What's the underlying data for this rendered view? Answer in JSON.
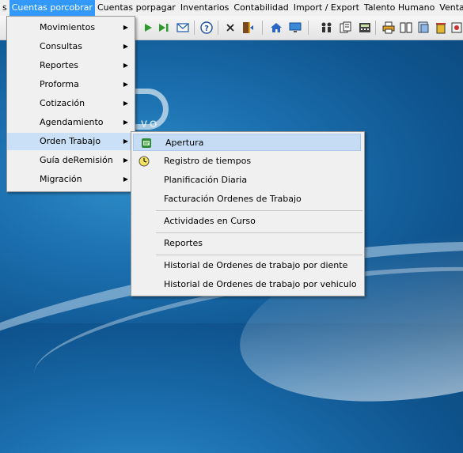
{
  "menubar": {
    "items": [
      "s",
      "Cuentas porcobrar",
      "Cuentas porpagar",
      "Inventarios",
      "Contabilidad",
      "Import / Export",
      "Talento Humano",
      "Ventana"
    ]
  },
  "toolbar": {
    "icons": [
      "play-icon",
      "skip-forward-icon",
      "mail-icon",
      "help-icon",
      "close-icon",
      "exit-door-icon",
      "home-icon",
      "monitor-icon",
      "users-icon",
      "documents-icon",
      "calculator-icon",
      "printer-icon",
      "book-icon",
      "window-icon",
      "trash-icon",
      "config-icon"
    ]
  },
  "submenu": {
    "items": [
      {
        "label": "Movimientos",
        "has_submenu": true
      },
      {
        "label": "Consultas",
        "has_submenu": true
      },
      {
        "label": "Reportes",
        "has_submenu": true
      },
      {
        "label": "Proforma",
        "has_submenu": true
      },
      {
        "label": "Cotización",
        "has_submenu": true
      },
      {
        "label": "Agendamiento",
        "has_submenu": true
      },
      {
        "label": "Orden Trabajo",
        "has_submenu": true
      },
      {
        "label": "Guía deRemisión",
        "has_submenu": true
      },
      {
        "label": "Migración",
        "has_submenu": true
      }
    ],
    "highlighted": "Orden Trabajo"
  },
  "orden_trabajo_menu": {
    "items": [
      {
        "label": "Apertura",
        "icon": "open-document-icon"
      },
      {
        "label": "Registro de tiempos",
        "icon": "clock-icon"
      },
      {
        "label": "Planificación Diaria"
      },
      {
        "label": "Facturación Ordenes de Trabajo"
      },
      {
        "label": "Actividades en Curso"
      },
      {
        "label": "Reportes"
      },
      {
        "label": "Historial de Ordenes de trabajo por diente"
      },
      {
        "label": "Historial de Ordenes de trabajo por vehiculo"
      }
    ],
    "highlighted": "Apertura"
  },
  "desktop": {
    "watermark_text": "VO"
  },
  "colors": {
    "menubar_active": "#3399ff",
    "menu_highlight": "#c9e0f7",
    "desktop": "#1b6fae"
  }
}
